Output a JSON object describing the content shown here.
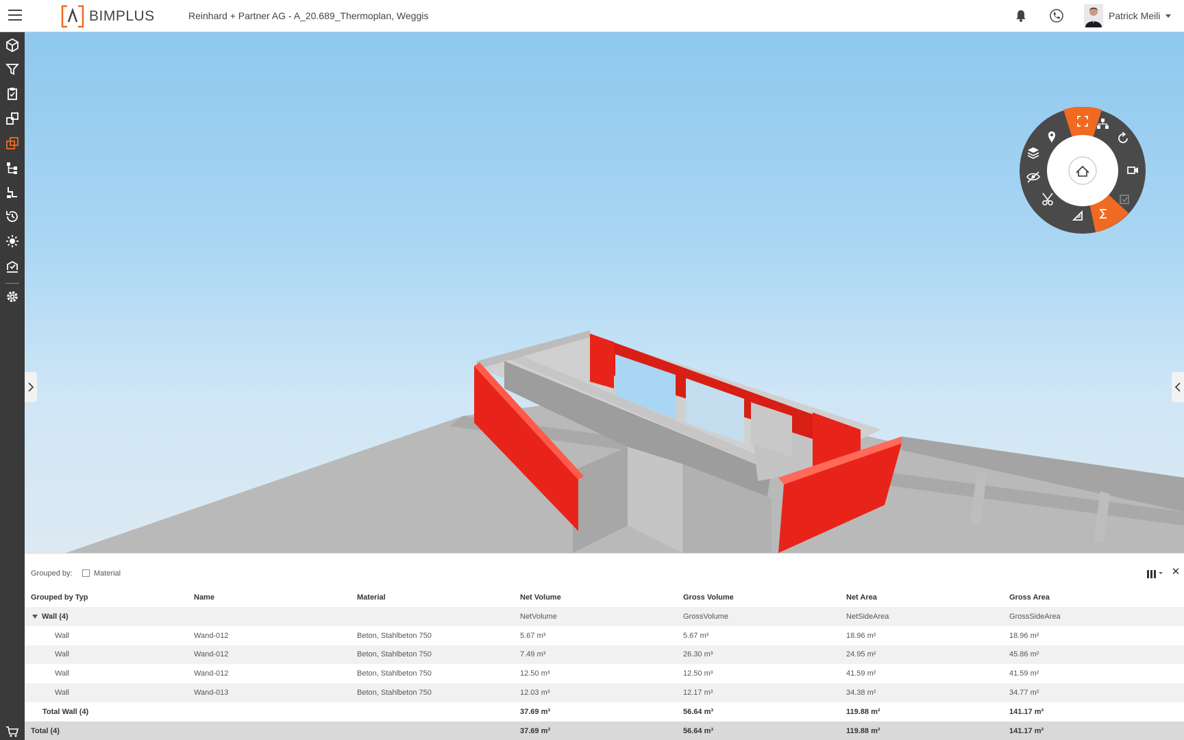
{
  "header": {
    "brand": "BIMPLUS",
    "project_title": "Reinhard + Partner AG  - A_20.689_Thermoplan, Weggis",
    "user_name": "Patrick Meili",
    "icons": [
      "menu-icon",
      "bell-icon",
      "phone-icon",
      "chevron-down-icon"
    ]
  },
  "toolbar_icons": [
    "cube-icon",
    "filter-icon",
    "clipboard-icon",
    "objects-icon",
    "layers-active-icon",
    "hierarchy-icon",
    "structure-icon",
    "history-icon",
    "light-icon",
    "checklist-icon",
    "settings-icon"
  ],
  "nav_wheel": {
    "center": "home-icon",
    "items": [
      "location-pin-icon",
      "fullscreen-icon",
      "tree-icon",
      "rotate-icon",
      "camera-icon",
      "issue-icon",
      "sigma-icon",
      "measure-icon",
      "scissors-icon",
      "hide-icon",
      "layers-icon"
    ],
    "active": [
      "fullscreen-icon",
      "sigma-icon"
    ]
  },
  "colors": {
    "accent": "#f06a22",
    "highlight_red": "#e8241a",
    "sidebar": "#3a3a3a"
  },
  "panel": {
    "grouped_by_label": "Grouped by:",
    "group_option": "Material",
    "columns": [
      "Grouped by Typ",
      "Name",
      "Material",
      "Net Volume",
      "Gross Volume",
      "Net Area",
      "Gross Area"
    ],
    "group_row": {
      "label": "Wall (4)",
      "net_volume": "NetVolume",
      "gross_volume": "GrossVolume",
      "net_area": "NetSideArea",
      "gross_area": "GrossSideArea"
    },
    "rows": [
      {
        "type": "Wall",
        "name": "Wand-012",
        "material": "Beton, Stahlbeton 750",
        "net_volume": "5.67 m³",
        "gross_volume": "5.67 m³",
        "net_area": "18.96 m²",
        "gross_area": "18.96 m²"
      },
      {
        "type": "Wall",
        "name": "Wand-012",
        "material": "Beton, Stahlbeton 750",
        "net_volume": "7.49 m³",
        "gross_volume": "26.30 m³",
        "net_area": "24.95 m²",
        "gross_area": "45.86 m²"
      },
      {
        "type": "Wall",
        "name": "Wand-012",
        "material": "Beton, Stahlbeton 750",
        "net_volume": "12.50 m³",
        "gross_volume": "12.50 m³",
        "net_area": "41.59 m²",
        "gross_area": "41.59 m²"
      },
      {
        "type": "Wall",
        "name": "Wand-013",
        "material": "Beton, Stahlbeton 750",
        "net_volume": "12.03 m³",
        "gross_volume": "12.17 m³",
        "net_area": "34.38 m²",
        "gross_area": "34.77 m²"
      }
    ],
    "total_wall": {
      "label": "Total Wall (4)",
      "net_volume": "37.69 m³",
      "gross_volume": "56.64 m³",
      "net_area": "119.88 m²",
      "gross_area": "141.17 m²"
    },
    "total": {
      "label": "Total (4)",
      "net_volume": "37.69 m³",
      "gross_volume": "56.64 m³",
      "net_area": "119.88 m²",
      "gross_area": "141.17 m²"
    }
  }
}
